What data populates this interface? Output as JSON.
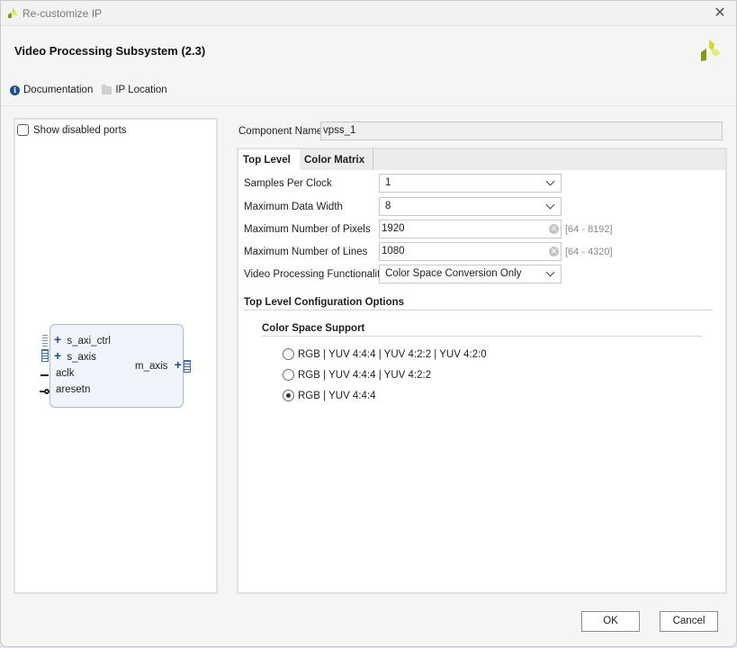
{
  "window": {
    "title": "Re-customize IP",
    "close_glyph": "✕"
  },
  "header": {
    "title": "Video Processing Subsystem (2.3)",
    "links": [
      {
        "label": "Documentation",
        "icon": "info-icon"
      },
      {
        "label": "IP Location",
        "icon": "folder-icon"
      }
    ]
  },
  "left_panel": {
    "show_disabled_ports_label": "Show disabled ports",
    "show_disabled_ports_checked": false,
    "ip_symbol": {
      "inputs": [
        "s_axi_ctrl",
        "s_axis",
        "aclk",
        "aresetn"
      ],
      "outputs": [
        "m_axis"
      ],
      "expand_glyph": "+"
    }
  },
  "component_name": {
    "label": "Component Name",
    "value": "vpss_1"
  },
  "tabs": [
    {
      "label": "Top Level",
      "active": true
    },
    {
      "label": "Color Matrix",
      "active": false
    }
  ],
  "top_level": {
    "fields": [
      {
        "label": "Samples Per Clock",
        "type": "select",
        "value": "1"
      },
      {
        "label": "Maximum Data Width",
        "type": "select",
        "value": "8"
      },
      {
        "label": "Maximum Number of Pixels",
        "type": "text",
        "value": "1920",
        "range": "[64 - 8192]"
      },
      {
        "label": "Maximum Number of Lines",
        "type": "text",
        "value": "1080",
        "range": "[64 - 4320]"
      },
      {
        "label": "Video Processing Functionality",
        "type": "select",
        "value": "Color Space Conversion Only"
      }
    ],
    "section_title": "Top Level Configuration Options",
    "color_space": {
      "title": "Color Space Support",
      "options": [
        {
          "label": "RGB | YUV 4:4:4 | YUV 4:2:2 | YUV 4:2:0",
          "selected": false
        },
        {
          "label": "RGB | YUV 4:4:4 | YUV 4:2:2",
          "selected": false
        },
        {
          "label": "RGB | YUV 4:4:4",
          "selected": true
        }
      ]
    }
  },
  "footer": {
    "ok_label": "OK",
    "cancel_label": "Cancel"
  },
  "colors": {
    "accent": "#1f4e8c",
    "logo_light": "#e2ec6e",
    "logo_mid": "#cfdb2a",
    "logo_dark": "#8a9a10"
  }
}
